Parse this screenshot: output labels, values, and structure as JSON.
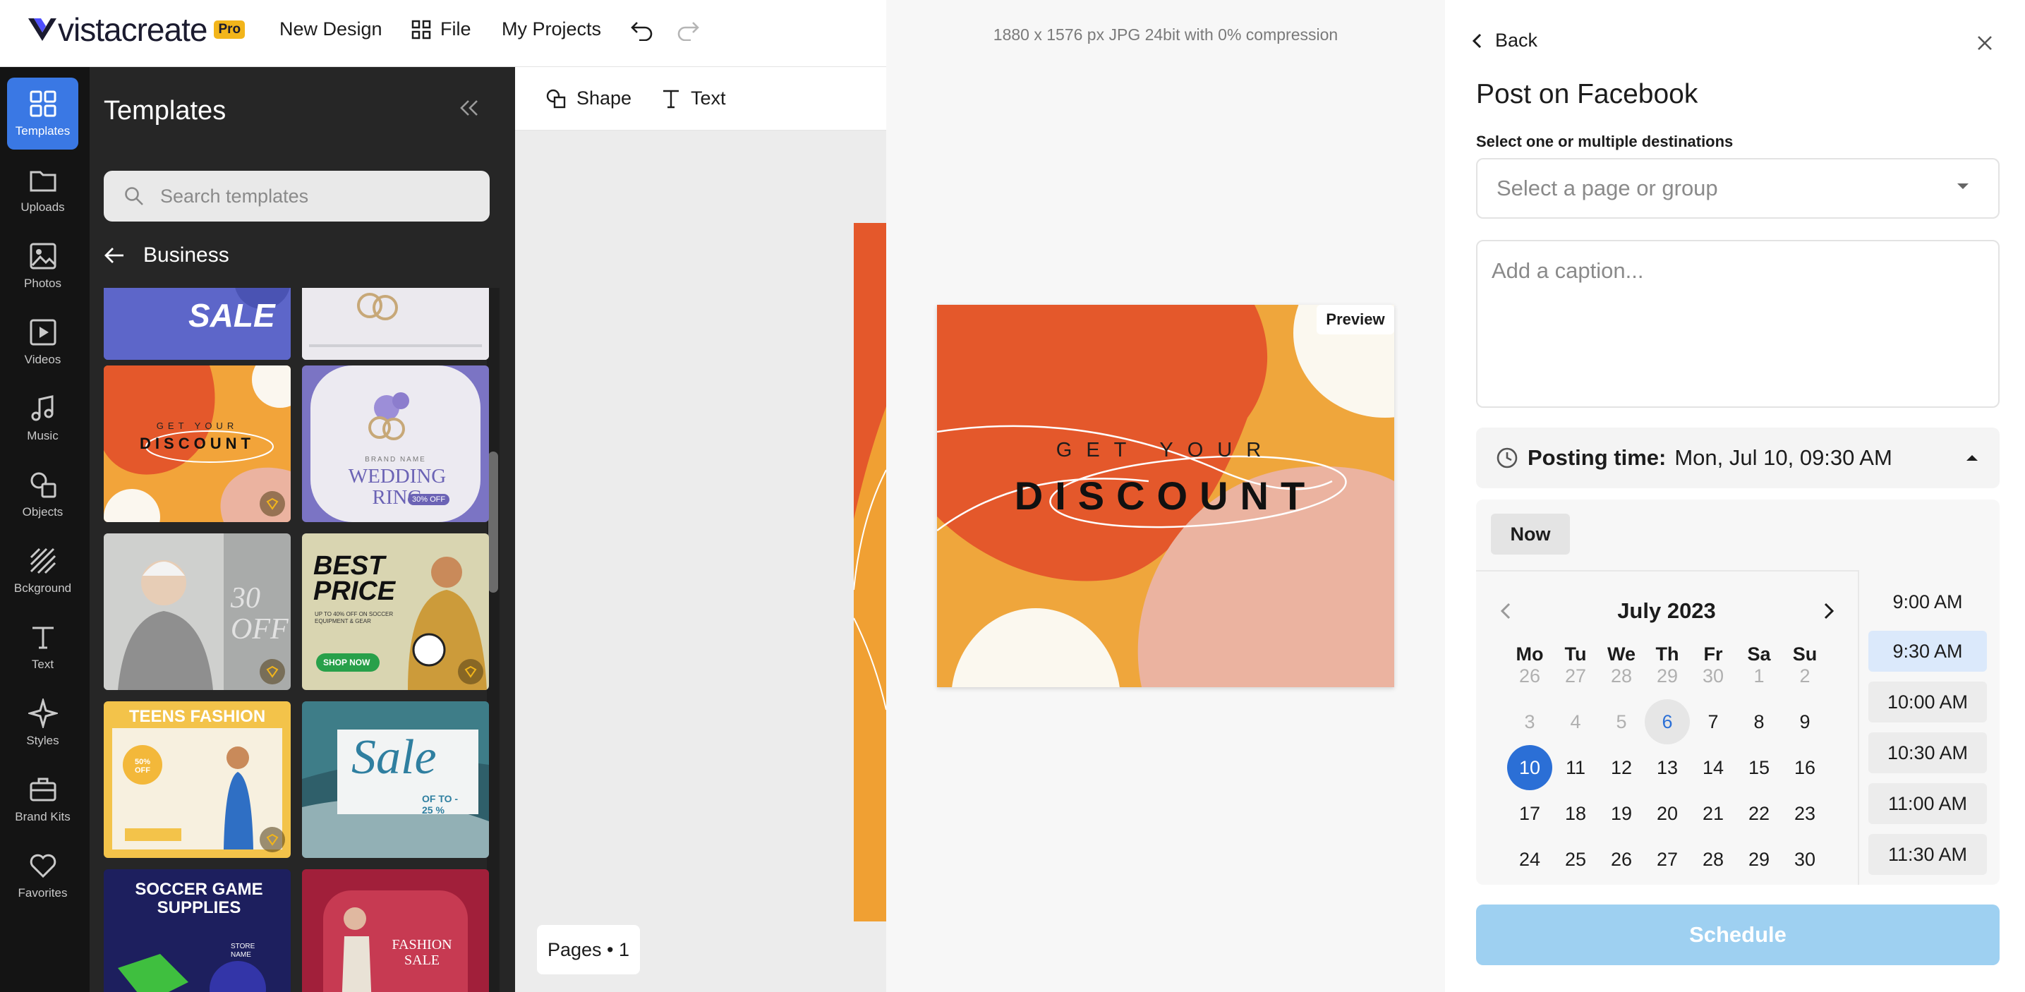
{
  "app": {
    "logo_text": "vistacreate",
    "badge": "Pro",
    "menu": {
      "new_design": "New Design",
      "file": "File",
      "my_projects": "My Projects"
    }
  },
  "rail": [
    {
      "id": "templates",
      "label": "Templates",
      "icon": "templates-icon"
    },
    {
      "id": "uploads",
      "label": "Uploads",
      "icon": "folder-icon"
    },
    {
      "id": "photos",
      "label": "Photos",
      "icon": "image-icon"
    },
    {
      "id": "videos",
      "label": "Videos",
      "icon": "video-icon"
    },
    {
      "id": "music",
      "label": "Music",
      "icon": "music-icon"
    },
    {
      "id": "objects",
      "label": "Objects",
      "icon": "objects-icon"
    },
    {
      "id": "background",
      "label": "Bckground",
      "icon": "background-icon"
    },
    {
      "id": "text",
      "label": "Text",
      "icon": "text-icon"
    },
    {
      "id": "styles",
      "label": "Styles",
      "icon": "sparkle-icon"
    },
    {
      "id": "brandkits",
      "label": "Brand Kits",
      "icon": "briefcase-icon"
    },
    {
      "id": "favorites",
      "label": "Favorites",
      "icon": "heart-icon"
    }
  ],
  "templates_panel": {
    "title": "Templates",
    "search_placeholder": "Search templates",
    "category": "Business",
    "cards": [
      {
        "text": "SALE"
      },
      {
        "text": ""
      },
      {
        "text": "GET YOUR DISCOUNT"
      },
      {
        "text": "WEDDING RING",
        "sub": "BRAND NAME",
        "tag": "30% OFF"
      },
      {
        "text": "30 OFF"
      },
      {
        "text": "BEST PRICE",
        "sub": "UP TO 40% OFF ON SOCCER EQUIPMENT & GEAR",
        "tag": "SHOP NOW"
      },
      {
        "text": "TEENS FASHION",
        "tag": "50% OFF"
      },
      {
        "text": "Sale",
        "sub": "OF TO - 25 %"
      },
      {
        "text": "SOCCER GAME SUPPLIES",
        "sub": "STORE NAME"
      },
      {
        "text": "FASHION SALE"
      }
    ]
  },
  "canvas_toolbar": {
    "shape": "Shape",
    "text": "Text"
  },
  "pages_label": "Pages • 1",
  "preview": {
    "file_info": "1880 x 1576 px JPG 24bit with 0% compression",
    "badge": "Preview",
    "headline_small": "GET YOUR",
    "headline_big": "DISCOUNT"
  },
  "schedule_panel": {
    "back": "Back",
    "title": "Post on Facebook",
    "destinations_label": "Select one or multiple destinations",
    "destinations_placeholder": "Select a page or group",
    "caption_placeholder": "Add a caption...",
    "posting_label": "Posting time:",
    "posting_value": "Mon, Jul 10, 09:30 AM",
    "now_button": "Now",
    "month_label": "July 2023",
    "weekdays": [
      "Mo",
      "Tu",
      "We",
      "Th",
      "Fr",
      "Sa",
      "Su"
    ],
    "weeks": [
      [
        "26",
        "27",
        "28",
        "29",
        "30",
        "1",
        "2"
      ],
      [
        "3",
        "4",
        "5",
        "6",
        "7",
        "8",
        "9"
      ],
      [
        "10",
        "11",
        "12",
        "13",
        "14",
        "15",
        "16"
      ],
      [
        "17",
        "18",
        "19",
        "20",
        "21",
        "22",
        "23"
      ],
      [
        "24",
        "25",
        "26",
        "27",
        "28",
        "29",
        "30"
      ]
    ],
    "muted_days": [
      "0-0",
      "0-1",
      "0-2",
      "0-3",
      "0-4",
      "0-5",
      "0-6",
      "1-0",
      "1-1",
      "1-2"
    ],
    "today_day": "1-3",
    "selected_day": "2-0",
    "times": [
      "9:00 AM",
      "9:30 AM",
      "10:00 AM",
      "10:30 AM",
      "11:00 AM",
      "11:30 AM"
    ],
    "selected_time": "9:30 AM",
    "schedule_button": "Schedule"
  },
  "colors": {
    "accent": "#2b6fd6",
    "schedule_disabled": "#9ed0f1",
    "rail_active": "#3a78e4",
    "discount_orange": "#ef9a2e",
    "discount_red": "#e4582b",
    "discount_pink": "#ebb3a0"
  }
}
